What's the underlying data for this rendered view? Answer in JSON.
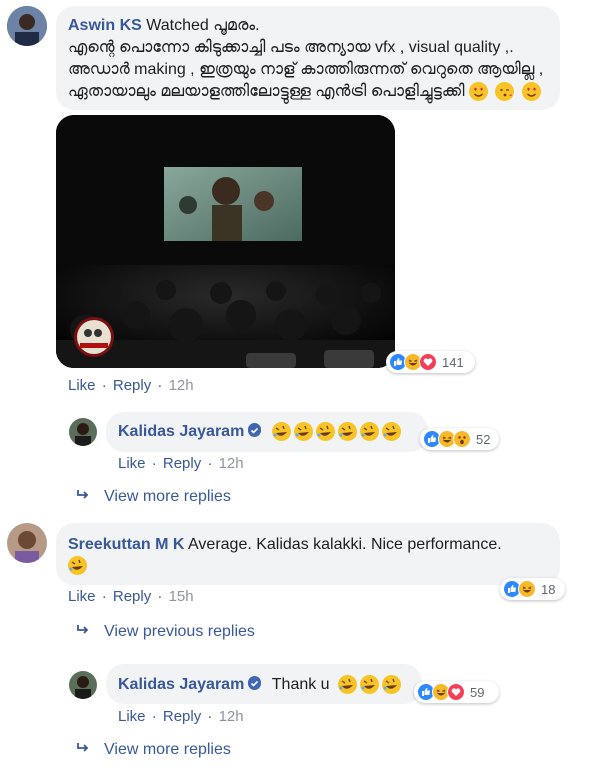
{
  "comments": [
    {
      "author": "Aswin KS",
      "text_lines": [
        "Watched പൂമരം.",
        "എന്റെ പൊന്നോ കിടുക്കാച്ചി പടം അന്യായ vfx , visual quality ,.",
        "അഡാർ making , ഇത്രയും നാള് കാത്തിരുന്നത് വെറുതെ ആയില്ല ,",
        "ഏതായാലും മലയാളത്തിലോട്ടുള്ള എൻട്രി പൊളിച്ചുട്ടക്കി"
      ],
      "end_emojis": [
        "heart-eyes",
        "kiss",
        "heart-eyes"
      ],
      "reaction_count": "141",
      "reactions": [
        "like",
        "haha",
        "love"
      ],
      "like_label": "Like",
      "reply_label": "Reply",
      "time": "12h"
    },
    {
      "author": "Kalidas Jayaram",
      "emojis": [
        "rofl",
        "rofl",
        "rofl",
        "rofl",
        "rofl",
        "rofl"
      ],
      "reaction_count": "52",
      "reactions": [
        "like",
        "haha",
        "wow"
      ],
      "like_label": "Like",
      "reply_label": "Reply",
      "time": "12h",
      "more_label": "View more replies"
    },
    {
      "author": "Sreekuttan M K",
      "text": "Average. Kalidas kalakki. Nice performance.",
      "emojis": [
        "rofl"
      ],
      "reaction_count": "18",
      "reactions": [
        "like",
        "haha"
      ],
      "like_label": "Like",
      "reply_label": "Reply",
      "time": "15h",
      "more_label": "View previous replies"
    },
    {
      "author": "Kalidas Jayaram",
      "text": "Thank u",
      "emojis": [
        "rofl",
        "rofl",
        "rofl"
      ],
      "reaction_count": "59",
      "reactions": [
        "like",
        "haha",
        "love"
      ],
      "like_label": "Like",
      "reply_label": "Reply",
      "time": "12h",
      "more_label": "View more replies"
    }
  ],
  "colors": {
    "link": "#385898",
    "bubble": "#f2f3f5",
    "meta": "#90949c",
    "like": "#2d88ff",
    "love": "#f33e58",
    "haha": "#f7b928"
  },
  "icons": {
    "reply": "reply-arrow-icon",
    "verified": "verified-badge-icon"
  }
}
